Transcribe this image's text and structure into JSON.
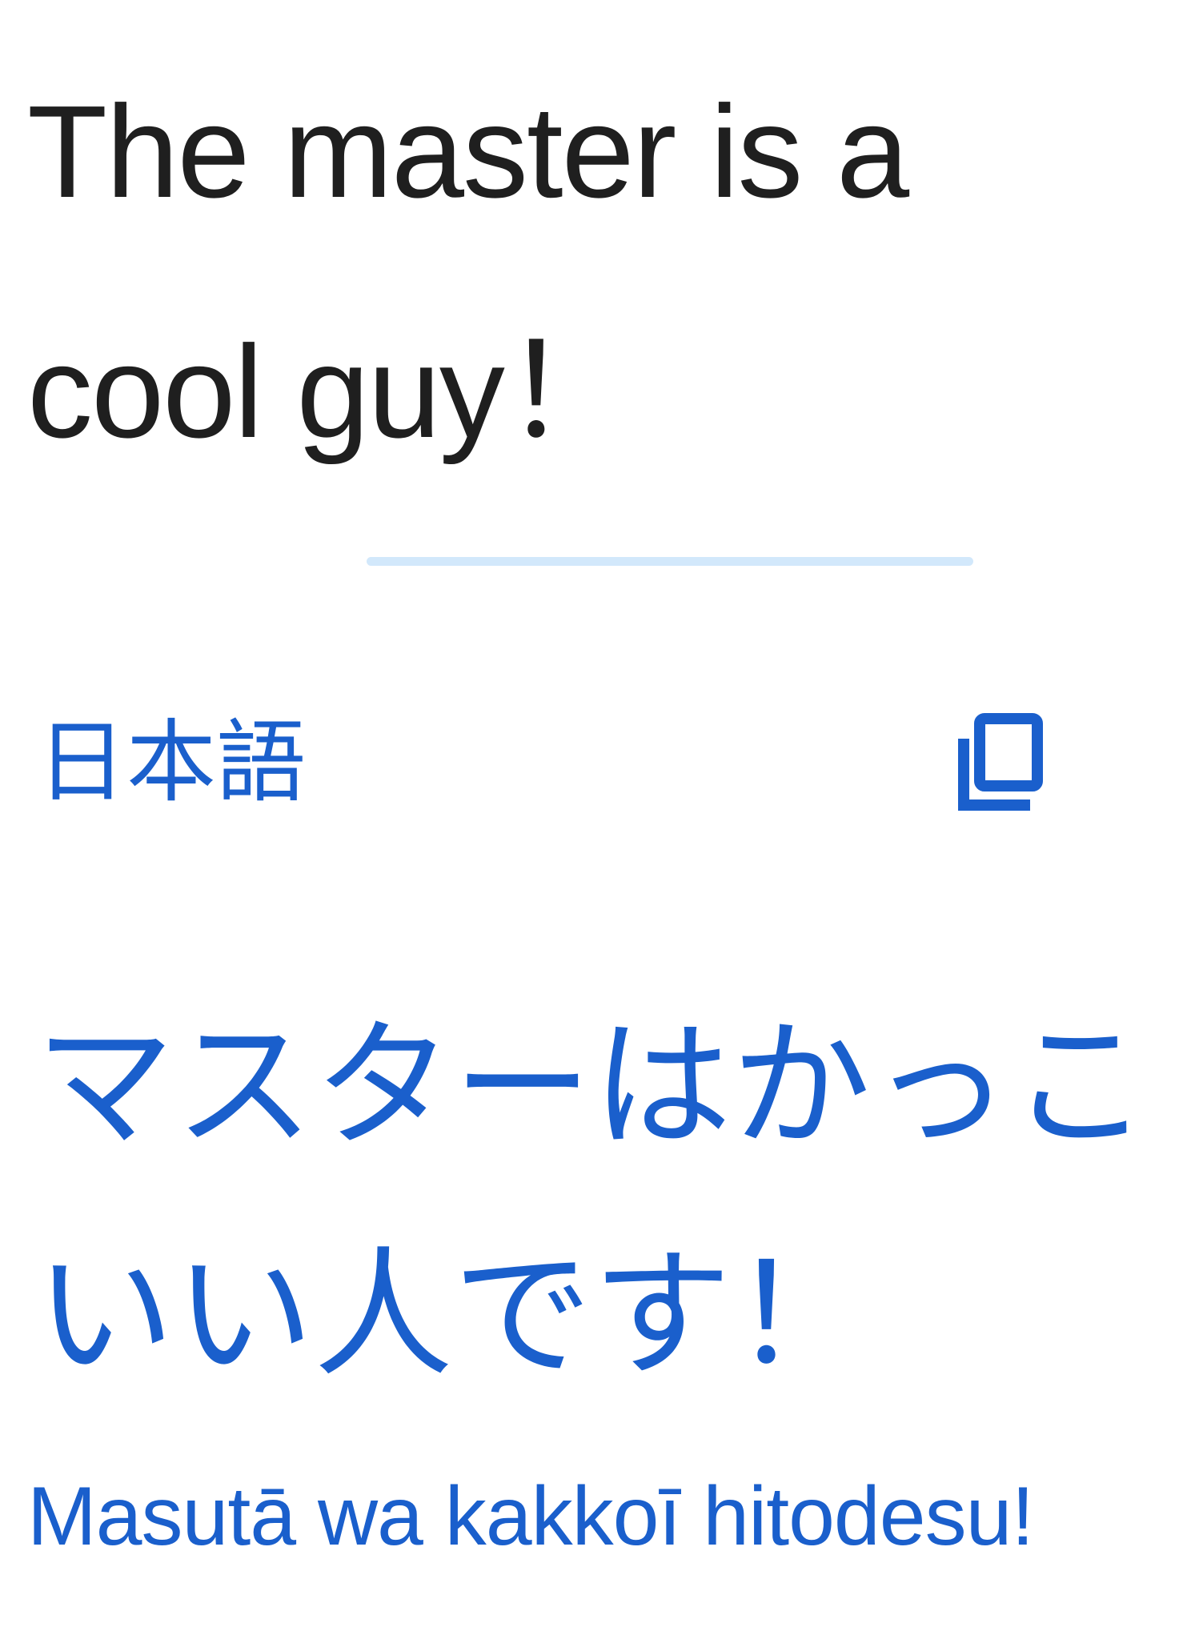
{
  "source": {
    "text": "The master is a\ncool guy！"
  },
  "target": {
    "language_label": "日本語",
    "copy_icon": "copy-icon",
    "text": "マスターはかっこ\nいい人です！",
    "romanization": "Masutā wa kakkoī hitodesu!"
  },
  "colors": {
    "accent": "#1a5fcc",
    "source_text": "#1f1f1f",
    "divider": "#d2e8fb",
    "background": "#ffffff"
  }
}
